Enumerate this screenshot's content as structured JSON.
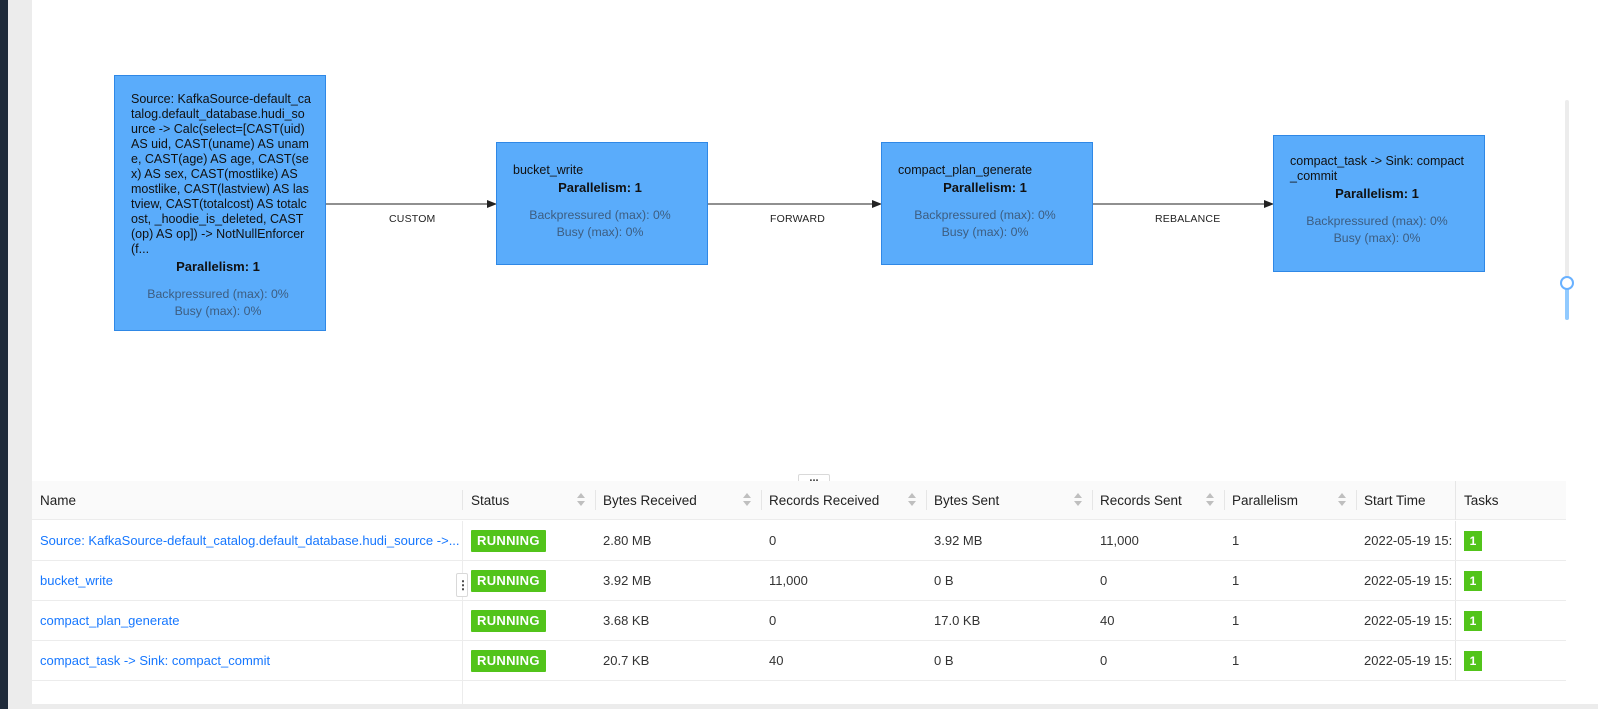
{
  "graph": {
    "nodes": [
      {
        "name": "Source: KafkaSource-default_catalog.default_database.hudi_source -> Calc(select=[CAST(uid) AS uid, CAST(uname) AS uname, CAST(age) AS age, CAST(sex) AS sex, CAST(mostlike) AS mostlike, CAST(lastview) AS lastview, CAST(totalcost) AS totalcost, _hoodie_is_deleted, CAST(op) AS op]) -> NotNullEnforcer(f...",
        "parallelism": "Parallelism: 1",
        "backpressured": "Backpressured (max): 0%",
        "busy": "Busy (max): 0%"
      },
      {
        "name": "bucket_write",
        "parallelism": "Parallelism: 1",
        "backpressured": "Backpressured (max): 0%",
        "busy": "Busy (max): 0%"
      },
      {
        "name": "compact_plan_generate",
        "parallelism": "Parallelism: 1",
        "backpressured": "Backpressured (max): 0%",
        "busy": "Busy (max): 0%"
      },
      {
        "name": "compact_task -> Sink: compact_commit",
        "parallelism": "Parallelism: 1",
        "backpressured": "Backpressured (max): 0%",
        "busy": "Busy (max): 0%"
      }
    ],
    "edges": [
      "CUSTOM",
      "FORWARD",
      "REBALANCE"
    ]
  },
  "resize_handle": "...",
  "table": {
    "columns": [
      "Name",
      "Status",
      "Bytes Received",
      "Records Received",
      "Bytes Sent",
      "Records Sent",
      "Parallelism",
      "Start Time",
      "Tasks"
    ],
    "rows": [
      {
        "name": "Source: KafkaSource-default_catalog.default_database.hudi_source ->...",
        "status": "RUNNING",
        "bytes_received": "2.80 MB",
        "records_received": "0",
        "bytes_sent": "3.92 MB",
        "records_sent": "11,000",
        "parallelism": "1",
        "start_time": "2022-05-19 15:",
        "tasks": "1"
      },
      {
        "name": "bucket_write",
        "status": "RUNNING",
        "bytes_received": "3.92 MB",
        "records_received": "11,000",
        "bytes_sent": "0 B",
        "records_sent": "0",
        "parallelism": "1",
        "start_time": "2022-05-19 15:",
        "tasks": "1"
      },
      {
        "name": "compact_plan_generate",
        "status": "RUNNING",
        "bytes_received": "3.68 KB",
        "records_received": "0",
        "bytes_sent": "17.0 KB",
        "records_sent": "40",
        "parallelism": "1",
        "start_time": "2022-05-19 15:",
        "tasks": "1"
      },
      {
        "name": "compact_task -> Sink: compact_commit",
        "status": "RUNNING",
        "bytes_received": "20.7 KB",
        "records_received": "40",
        "bytes_sent": "0 B",
        "records_sent": "0",
        "parallelism": "1",
        "start_time": "2022-05-19 15:",
        "tasks": "1"
      }
    ]
  },
  "colors": {
    "node_fill": "#5aacfb",
    "running": "#52c41a",
    "link": "#1677ff"
  }
}
